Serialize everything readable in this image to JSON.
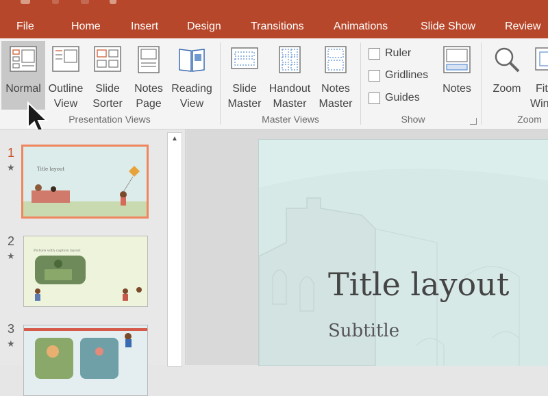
{
  "menu": [
    "File",
    "Home",
    "Insert",
    "Design",
    "Transitions",
    "Animations",
    "Slide Show",
    "Review"
  ],
  "ribbon": {
    "presentation_views": {
      "group_label": "Presentation Views",
      "buttons": [
        {
          "line1": "Normal",
          "line2": "",
          "icon": "normal-view-icon",
          "selected": true
        },
        {
          "line1": "Outline",
          "line2": "View",
          "icon": "outline-view-icon"
        },
        {
          "line1": "Slide",
          "line2": "Sorter",
          "icon": "slide-sorter-icon"
        },
        {
          "line1": "Notes",
          "line2": "Page",
          "icon": "notes-page-icon"
        },
        {
          "line1": "Reading",
          "line2": "View",
          "icon": "reading-view-icon"
        }
      ]
    },
    "master_views": {
      "group_label": "Master Views",
      "buttons": [
        {
          "line1": "Slide",
          "line2": "Master",
          "icon": "slide-master-icon"
        },
        {
          "line1": "Handout",
          "line2": "Master",
          "icon": "handout-master-icon"
        },
        {
          "line1": "Notes",
          "line2": "Master",
          "icon": "notes-master-icon"
        }
      ]
    },
    "show": {
      "group_label": "Show",
      "checkboxes": [
        {
          "label": "Ruler",
          "checked": false
        },
        {
          "label": "Gridlines",
          "checked": false
        },
        {
          "label": "Guides",
          "checked": false
        }
      ],
      "notes_button": "Notes"
    },
    "zoom": {
      "group_label": "Zoom",
      "zoom_button": "Zoom",
      "fit_line1": "Fit",
      "fit_line2": "Win"
    }
  },
  "slides": [
    {
      "number": "1",
      "title": "Title layout",
      "selected": true
    },
    {
      "number": "2",
      "title": "Picture with caption layout"
    },
    {
      "number": "3",
      "title": ""
    }
  ],
  "current_slide": {
    "title": "Title layout",
    "subtitle": "Subtitle"
  },
  "colors": {
    "accent": "#b7472a",
    "selection": "#f0855e",
    "slide_bg": "#d7e9e7"
  }
}
